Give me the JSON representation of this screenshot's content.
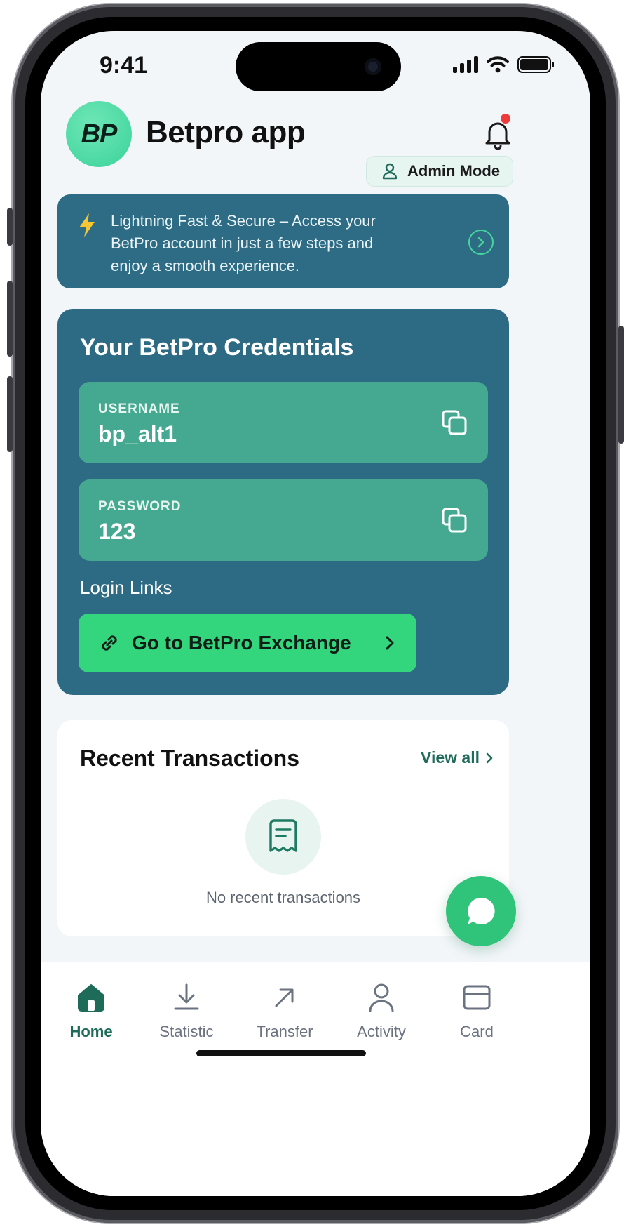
{
  "status_bar": {
    "time": "9:41"
  },
  "header": {
    "logo_text": "BP",
    "title": "Betpro app",
    "admin_label": "Admin Mode"
  },
  "promo": {
    "text": "Lightning Fast & Secure – Access your BetPro account in just a few steps and enjoy a smooth experience."
  },
  "credentials": {
    "title": "Your BetPro Credentials",
    "username_label": "USERNAME",
    "username_value": "bp_alt1",
    "password_label": "PASSWORD",
    "password_value": "123",
    "login_links_label": "Login Links",
    "exchange_button": "Go to BetPro Exchange"
  },
  "recent": {
    "title": "Recent Transactions",
    "view_all": "View all",
    "empty_text": "No recent transactions"
  },
  "nav": {
    "items": [
      {
        "label": "Home",
        "icon": "home-icon"
      },
      {
        "label": "Statistic",
        "icon": "download-icon"
      },
      {
        "label": "Transfer",
        "icon": "arrow-up-right-icon"
      },
      {
        "label": "Activity",
        "icon": "user-icon"
      },
      {
        "label": "Card",
        "icon": "card-icon"
      }
    ],
    "active": "Home"
  },
  "colors": {
    "accent_green": "#33d67d",
    "panel_blue": "#2d6a84",
    "field_green": "#45a890",
    "nav_active": "#1d6b58",
    "notification_dot": "#ef3b3b"
  }
}
